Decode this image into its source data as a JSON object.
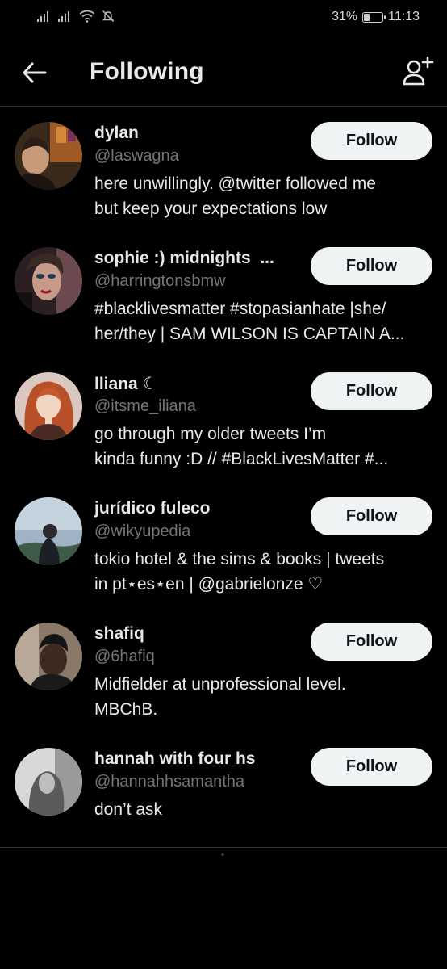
{
  "status_bar": {
    "battery": "31%",
    "battery_level": 0.31,
    "time": "11:13"
  },
  "header": {
    "title": "Following"
  },
  "users": [
    {
      "name": "dylan ",
      "handle": "@laswagna",
      "bio": [
        "here unwillingly. @twitter followed me",
        "but keep your expectations low"
      ],
      "follow_label": "Follow"
    },
    {
      "name": "sophie :) midnights  ...",
      "handle": "@harringtonsbmw",
      "bio": [
        "#blacklivesmatter #stopasianhate |she/",
        "her/they | SAM WILSON IS CAPTAIN A..."
      ],
      "follow_label": "Follow"
    },
    {
      "name": "lliana ☾",
      "handle": "@itsme_iliana",
      "bio": [
        "go through my older tweets I’m",
        "kinda funny :D // #BlackLivesMatter #..."
      ],
      "follow_label": "Follow"
    },
    {
      "name": "jurídico fuleco",
      "handle": "@wikyupedia",
      "bio": [
        "tokio hotel & the sims & books | tweets",
        "in pt⋆es⋆en | @gabrielonze ♡"
      ],
      "follow_label": "Follow"
    },
    {
      "name": "shafiq",
      "handle": "@6hafiq",
      "bio": [
        "Midfielder at unprofessional level.",
        "MBChB."
      ],
      "follow_label": "Follow"
    },
    {
      "name": "hannah with four hs",
      "handle": "@hannahhsamantha",
      "bio": [
        "don’t ask"
      ],
      "follow_label": "Follow"
    }
  ]
}
